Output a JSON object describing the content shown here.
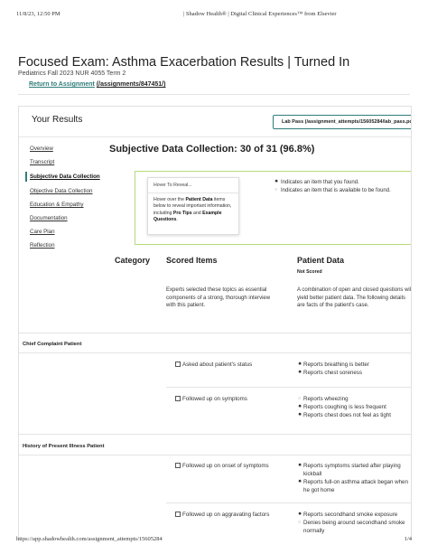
{
  "print_header": {
    "datetime": "11/8/23, 12:50 PM",
    "site_title": "| Shadow Health® | Digital Clinical Experiences™ from Elsevier"
  },
  "print_footer": {
    "url": "https://app.shadowhealth.com/assignment_attempts/15605284",
    "page": "1/4"
  },
  "page": {
    "title": "Focused Exam: Asthma Exacerbation Results | Turned In",
    "subtitle": "Pediatrics Fall 2023 NUR 4055 Term 2",
    "return_link_text": "Return to Assignment",
    "return_link_path": "(/assignments/847451/)"
  },
  "results": {
    "heading": "Your Results",
    "lab_pass_label": "Lab Pass (/assignment_attempts/15605284/lab_pass.pdf)"
  },
  "sidebar": {
    "items": [
      {
        "label": "Overview",
        "active": false
      },
      {
        "label": "Transcript",
        "active": false
      },
      {
        "label": "Subjective Data Collection",
        "active": true
      },
      {
        "label": "Objective Data Collection",
        "active": false
      },
      {
        "label": "Education & Empathy",
        "active": false
      },
      {
        "label": "Documentation",
        "active": false
      },
      {
        "label": "Care Plan",
        "active": false
      },
      {
        "label": "Reflection",
        "active": false
      }
    ]
  },
  "section": {
    "title": "Subjective Data Collection: 30 of 31 (96.8%)",
    "hover_title": "Hover To Reveal...",
    "hover_text_1": "Hover over the ",
    "hover_text_bold_1": "Patient Data",
    "hover_text_2": " items below to reveal important information, including ",
    "hover_text_bold_2": "Pro Tips",
    "hover_text_3": " and ",
    "hover_text_bold_3": "Example Questions",
    "hover_text_4": ".",
    "legend_1": "Indicates an item that you found.",
    "legend_2": "Indicates an item that is available to be found."
  },
  "columns": {
    "category": "Category",
    "scored_items": "Scored Items",
    "patient_data": "Patient Data",
    "patient_data_sub": "Not Scored"
  },
  "explanations": {
    "scored": "Experts selected these topics as essential components of a strong, thorough interview with this patient.",
    "patient": "A combination of open and closed questions will yield better patient data. The following details are facts of the patient's case."
  },
  "groups": [
    {
      "name": "Chief Complaint Patient",
      "items": [
        {
          "scored": "Asked about patient's status",
          "data": [
            {
              "text": "Reports breathing is better",
              "found": true
            },
            {
              "text": "Reports chest soreness",
              "found": true
            }
          ]
        },
        {
          "scored": "Followed up on symptoms",
          "data": [
            {
              "text": "Reports wheezing",
              "found": false
            },
            {
              "text": "Reports coughing is less frequent",
              "found": true
            },
            {
              "text": "Reports chest does not feel as tight",
              "found": true
            }
          ]
        }
      ]
    },
    {
      "name": "History of Present Illness Patient",
      "items": [
        {
          "scored": "Followed up on onset of symptoms",
          "data": [
            {
              "text": "Reports symptoms started after playing kickball",
              "found": true
            },
            {
              "text": "Reports full-on asthma attack began when he got home",
              "found": true
            }
          ]
        },
        {
          "scored": "Followed up on aggravating factors",
          "data": [
            {
              "text": "Reports secondhand smoke exposure",
              "found": true
            },
            {
              "text": "Denies being around secondhand smoke normally",
              "found": false
            }
          ]
        }
      ]
    }
  ]
}
